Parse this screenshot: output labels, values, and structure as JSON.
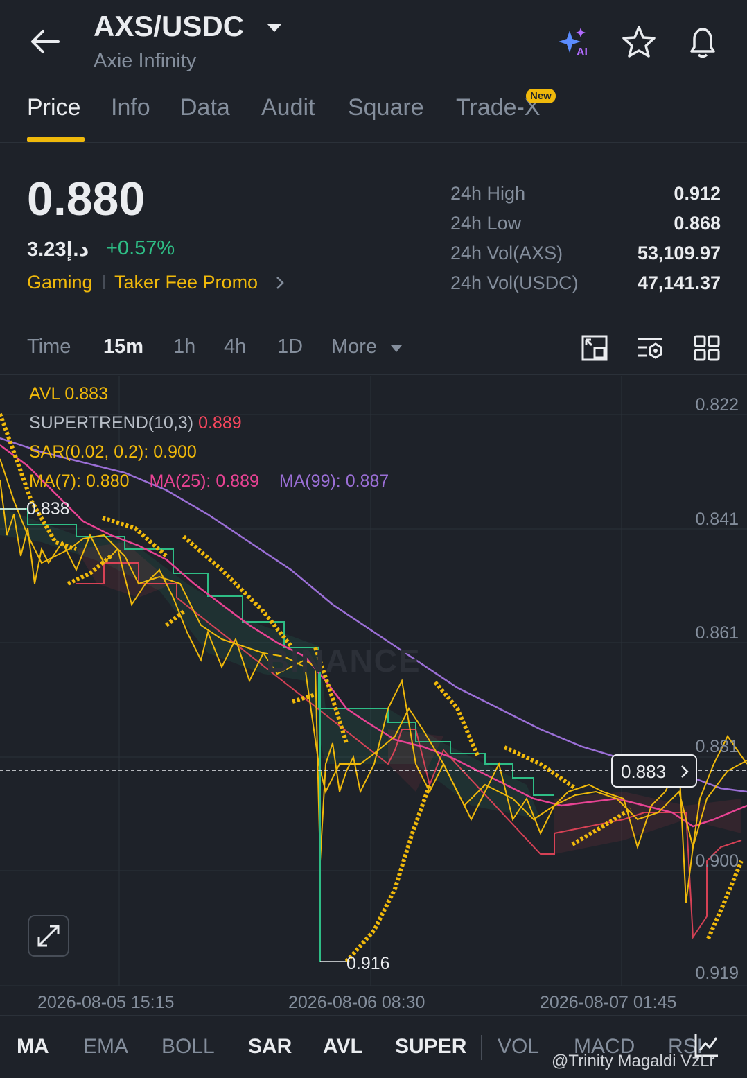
{
  "header": {
    "pair": "AXS/USDC",
    "name": "Axie Infinity"
  },
  "tabs": [
    {
      "label": "Price",
      "active": true
    },
    {
      "label": "Info"
    },
    {
      "label": "Data"
    },
    {
      "label": "Audit"
    },
    {
      "label": "Square"
    },
    {
      "label": "Trade-X",
      "badge": "New"
    }
  ],
  "ticker": {
    "last_price": "0.880",
    "fiat_price": "3.23د.إ",
    "change": "+0.57%",
    "tags": [
      "Gaming",
      "Taker Fee Promo"
    ],
    "stats": [
      {
        "label": "24h High",
        "value": "0.912"
      },
      {
        "label": "24h Low",
        "value": "0.868"
      },
      {
        "label": "24h Vol(AXS)",
        "value": "53,109.97"
      },
      {
        "label": "24h Vol(USDC)",
        "value": "47,141.37"
      }
    ]
  },
  "timeframes": {
    "items": [
      "Time",
      "15m",
      "1h",
      "4h",
      "1D",
      "More"
    ],
    "selected": "15m"
  },
  "chart": {
    "indicators": {
      "avl": "AVL 0.883",
      "supertrend_label": "SUPERTREND(10,3)",
      "supertrend_value": "0.889",
      "sar": "SAR(0.02, 0.2): 0.900",
      "ma7": "MA(7): 0.880",
      "ma25": "MA(25): 0.889",
      "ma99": "MA(99): 0.887"
    },
    "y_labels": [
      "0.822",
      "0.841",
      "0.861",
      "0.881",
      "0.900",
      "0.919"
    ],
    "x_labels": [
      "2026-08-05 15:15",
      "2026-08-06 08:30",
      "2026-08-07 01:45"
    ],
    "current_price": "0.883",
    "marked_low": "0.916",
    "marked_high": "0.838",
    "watermark": "BINANCE"
  },
  "indicator_tabs": {
    "items": [
      "MA",
      "EMA",
      "BOLL",
      "SAR",
      "AVL",
      "SUPER",
      "VOL",
      "MACD",
      "RSI"
    ],
    "active": [
      "MA",
      "SAR",
      "AVL",
      "SUPER"
    ]
  },
  "credit": "@Trinity Magaldi VzLr",
  "colors": {
    "accent": "#f0b90b",
    "up": "#2ebd85",
    "down": "#f6465d",
    "ma7": "#f0b90b",
    "ma25": "#e84393",
    "ma99": "#9b6fd6",
    "supertrend_up": "#2ebd85",
    "supertrend_down": "#f6465d"
  }
}
